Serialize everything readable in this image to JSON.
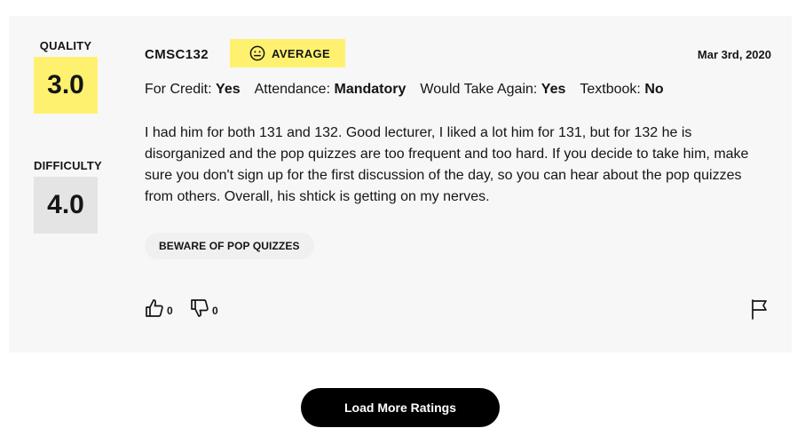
{
  "rating": {
    "quality_label": "QUALITY",
    "quality_value": "3.0",
    "difficulty_label": "DIFFICULTY",
    "difficulty_value": "4.0",
    "course": "CMSC132",
    "emotion_label": "AVERAGE",
    "emotion_icon": "neutral-face-icon",
    "date": "Mar 3rd, 2020",
    "meta": [
      {
        "label": "For Credit:",
        "value": "Yes"
      },
      {
        "label": "Attendance:",
        "value": "Mandatory"
      },
      {
        "label": "Would Take Again:",
        "value": "Yes"
      },
      {
        "label": "Textbook:",
        "value": "No"
      }
    ],
    "comment": "I had him for both 131 and 132. Good lecturer, I liked a lot him for 131, but for 132 he is disorganized and the pop quizzes are too frequent and too hard. If you decide to take him, make sure you don't sign up for the first discussion of the day, so you can hear about the pop quizzes from others. Overall, his shtick is getting on my nerves.",
    "tag": "BEWARE OF POP QUIZZES",
    "thumbs_up_count": "0",
    "thumbs_down_count": "0"
  },
  "load_more_label": "Load More Ratings",
  "colors": {
    "quality_bg": "#fff170",
    "difficulty_bg": "#e4e4e4",
    "card_bg": "#f7f7f7",
    "button_bg": "#000000"
  }
}
